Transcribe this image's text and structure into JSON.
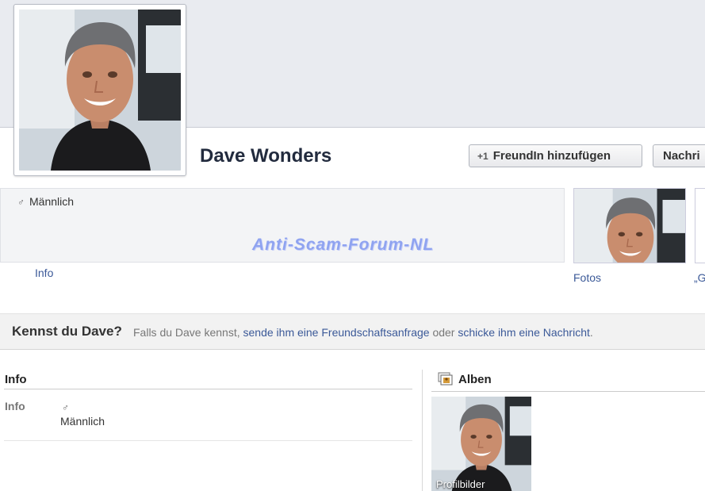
{
  "profile": {
    "name": "Dave Wonders",
    "gender_icon": "male-icon",
    "gender_symbol": "♂",
    "gender": "Männlich"
  },
  "actions": {
    "add_friend_label": "FreundIn hinzufügen",
    "add_friend_icon": "+1",
    "message_label": "Nachri"
  },
  "tabs": {
    "info": "Info",
    "photos": "Fotos",
    "cut_tab": "„G"
  },
  "watermark": "Anti-Scam-Forum-NL",
  "know_prompt": {
    "heading": "Kennst du Dave?",
    "text_prefix": "Falls du Dave kennst,",
    "link_friend_request": "sende ihm eine Freundschaftsanfrage",
    "text_middle": "oder",
    "link_message": "schicke ihm eine Nachricht",
    "text_suffix": "."
  },
  "info_section": {
    "title": "Info",
    "label": "Info",
    "gender_symbol": "♂",
    "gender": "Männlich"
  },
  "albums_section": {
    "title": "Alben",
    "icon": "albums-icon",
    "album_caption": "Profilbilder"
  },
  "colors": {
    "link": "#3b5998",
    "cover": "#e9ebf0",
    "watermark": "#8fa3f0"
  }
}
